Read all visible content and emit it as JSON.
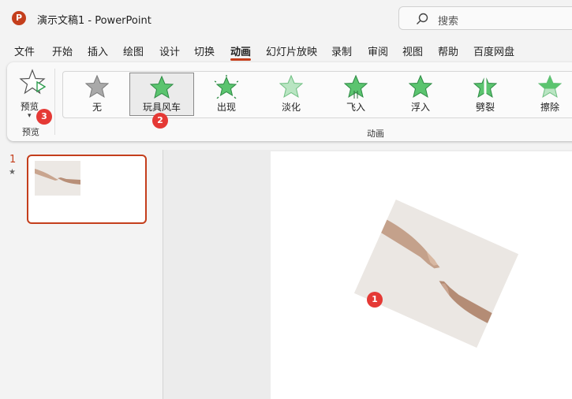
{
  "app": {
    "logo_letter": "P",
    "title": "演示文稿1  -  PowerPoint",
    "accent": "#c43e1c"
  },
  "search": {
    "label": "搜索"
  },
  "menu": {
    "items": [
      "文件",
      "开始",
      "插入",
      "绘图",
      "设计",
      "切换",
      "动画",
      "幻灯片放映",
      "录制",
      "审阅",
      "视图",
      "帮助",
      "百度网盘"
    ],
    "active": "动画"
  },
  "ribbon": {
    "preview": {
      "label": "预览",
      "group_label": "预览"
    },
    "animation_group_label": "动画",
    "effects": [
      {
        "label": "无",
        "icon": "none-star-icon"
      },
      {
        "label": "玩具风车",
        "icon": "pinwheel-star-icon",
        "selected": true
      },
      {
        "label": "出现",
        "icon": "appear-star-icon"
      },
      {
        "label": "淡化",
        "icon": "fade-star-icon"
      },
      {
        "label": "飞入",
        "icon": "fly-in-star-icon"
      },
      {
        "label": "浮入",
        "icon": "float-in-star-icon"
      },
      {
        "label": "劈裂",
        "icon": "split-star-icon"
      },
      {
        "label": "擦除",
        "icon": "wipe-star-icon"
      }
    ]
  },
  "thumbnails": {
    "slide_number": "1",
    "animation_mark": "★"
  },
  "badges": {
    "slide_image": "1",
    "effect": "2",
    "preview": "3"
  }
}
